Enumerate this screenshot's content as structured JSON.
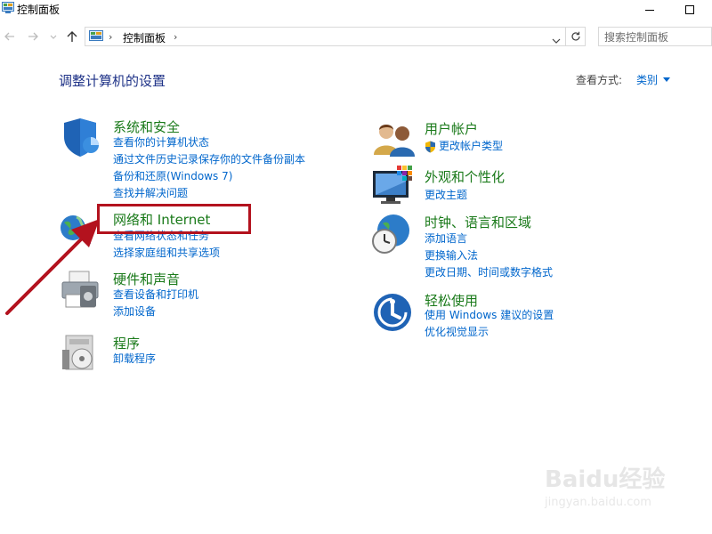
{
  "window": {
    "title": "控制面板"
  },
  "navbar": {
    "breadcrumb": "控制面板",
    "search_placeholder": "搜索控制面板"
  },
  "main": {
    "heading": "调整计算机的设置",
    "view_by_label": "查看方式:",
    "view_by_value": "类别"
  },
  "left_categories": [
    {
      "title": "系统和安全",
      "icon": "shield-icon",
      "links": [
        "查看你的计算机状态",
        "通过文件历史记录保存你的文件备份副本",
        "备份和还原(Windows 7)",
        "查找并解决问题"
      ]
    },
    {
      "title": "网络和 Internet",
      "icon": "globe-network-icon",
      "links": [
        "查看网络状态和任务",
        "选择家庭组和共享选项"
      ]
    },
    {
      "title": "硬件和声音",
      "icon": "printer-icon",
      "links": [
        "查看设备和打印机",
        "添加设备"
      ]
    },
    {
      "title": "程序",
      "icon": "programs-disc-icon",
      "links": [
        "卸载程序"
      ]
    }
  ],
  "right_categories": [
    {
      "title": "用户帐户",
      "icon": "users-icon",
      "links": [
        "更改帐户类型"
      ]
    },
    {
      "title": "外观和个性化",
      "icon": "monitor-palette-icon",
      "links": [
        "更改主题"
      ]
    },
    {
      "title": "时钟、语言和区域",
      "icon": "clock-globe-icon",
      "links": [
        "添加语言",
        "更换输入法",
        "更改日期、时间或数字格式"
      ]
    },
    {
      "title": "轻松使用",
      "icon": "ease-of-access-icon",
      "links": [
        "使用 Windows 建议的设置",
        "优化视觉显示"
      ]
    }
  ],
  "watermark": {
    "brand": "Baidu经验",
    "url": "jingyan.baidu.com"
  },
  "colors": {
    "category_title": "#1a7a1a",
    "link": "#0066cc",
    "heading": "#1e3287",
    "annotation": "#b3121e"
  }
}
